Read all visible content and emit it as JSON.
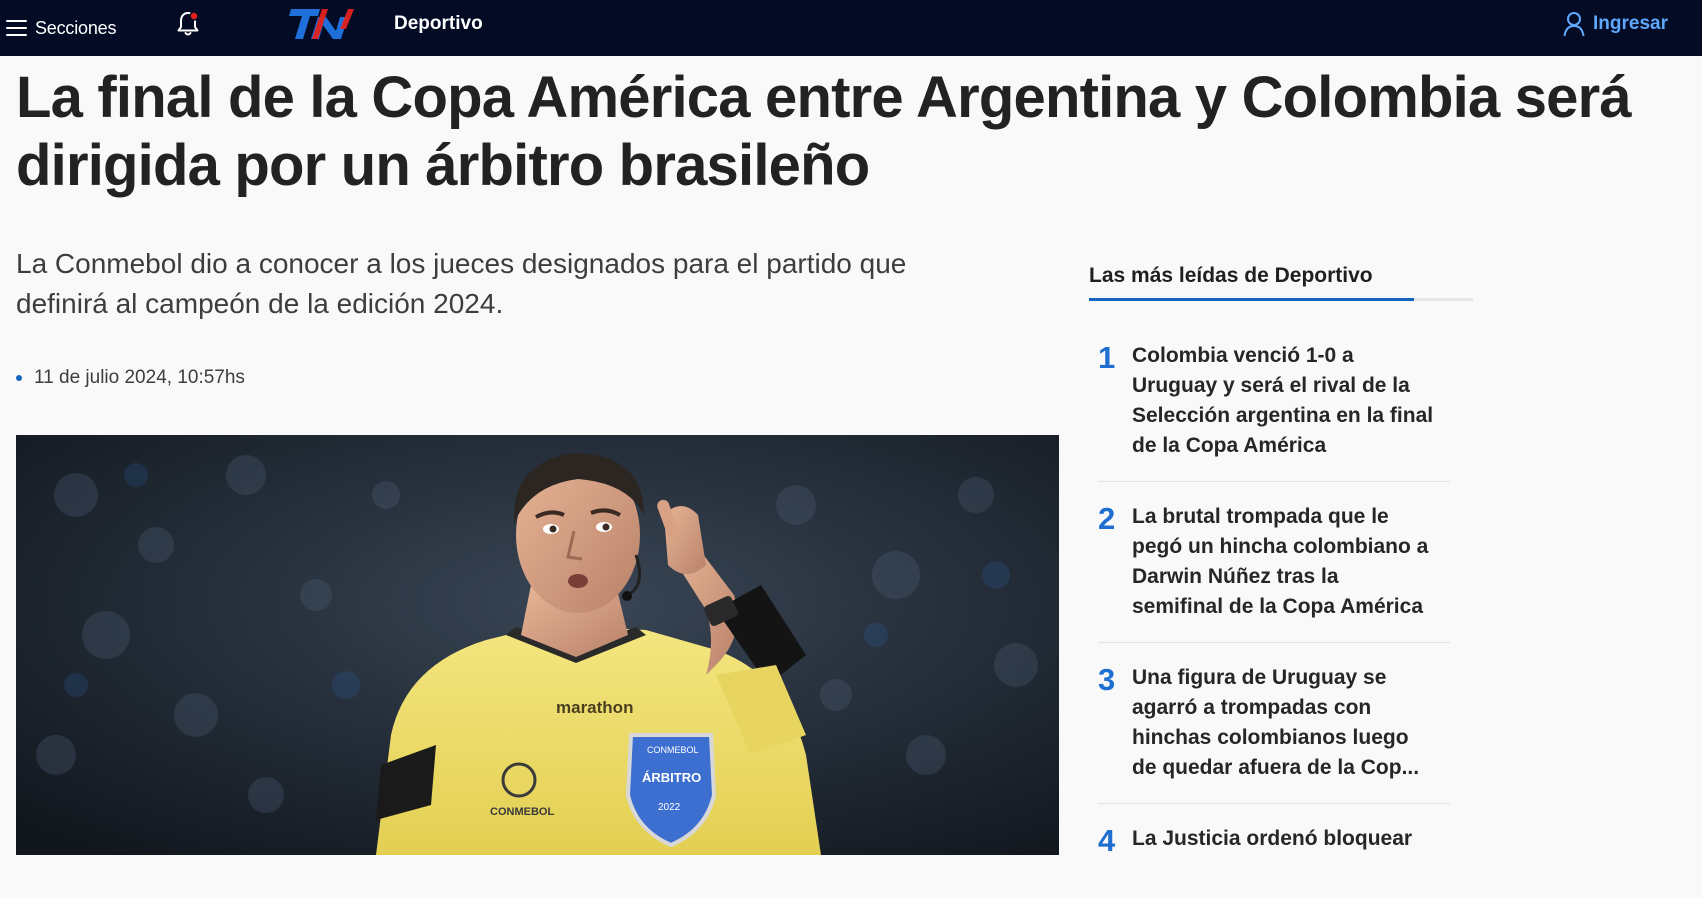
{
  "topbar": {
    "menu_label": "Secciones",
    "section_label": "Deportivo",
    "login_label": "Ingresar",
    "logo_alt": "TN",
    "colors": {
      "background": "#030b25",
      "login": "#5fa8ff",
      "logo_blue": "#1e6fd9",
      "logo_red": "#e2211c",
      "notification_dot": "#e2211c"
    },
    "icons": [
      "hamburger-icon",
      "bell-icon",
      "user-icon"
    ]
  },
  "article": {
    "headline_lines": [
      "La final de la Copa América entre Argentina y Colombia será",
      "dirigida por un árbitro brasileño"
    ],
    "lead_lines": [
      "La Conmebol dio a conocer a los jueces designados para el partido que",
      "definirá al campeón de la edición 2024."
    ],
    "date": "11 de julio 2024, 10:57hs",
    "hero_image": {
      "description": "Referee in yellow shirt touching his temple",
      "jersey_brand": "marathon",
      "badge_text": "ÁRBITRO",
      "badge_top": "CONMEBOL",
      "badge_year": "2022",
      "patch_text": "CONMEBOL"
    }
  },
  "most_read": {
    "title": "Las más leídas de Deportivo",
    "accent_color": "#1565c0",
    "items": [
      {
        "number": "1",
        "lines": [
          "Colombia venció 1-0 a",
          "Uruguay y será el rival de la",
          "Selección argentina en la final",
          "de la Copa América"
        ]
      },
      {
        "number": "2",
        "lines": [
          "La brutal trompada que le",
          "pegó un hincha colombiano a",
          "Darwin Núñez tras la",
          "semifinal de la Copa América"
        ]
      },
      {
        "number": "3",
        "lines": [
          "Una figura de Uruguay se",
          "agarró a trompadas con",
          "hinchas colombianos luego",
          "de quedar afuera de la Cop..."
        ]
      },
      {
        "number": "4",
        "lines": [
          "La Justicia ordenó bloquear"
        ]
      }
    ]
  }
}
